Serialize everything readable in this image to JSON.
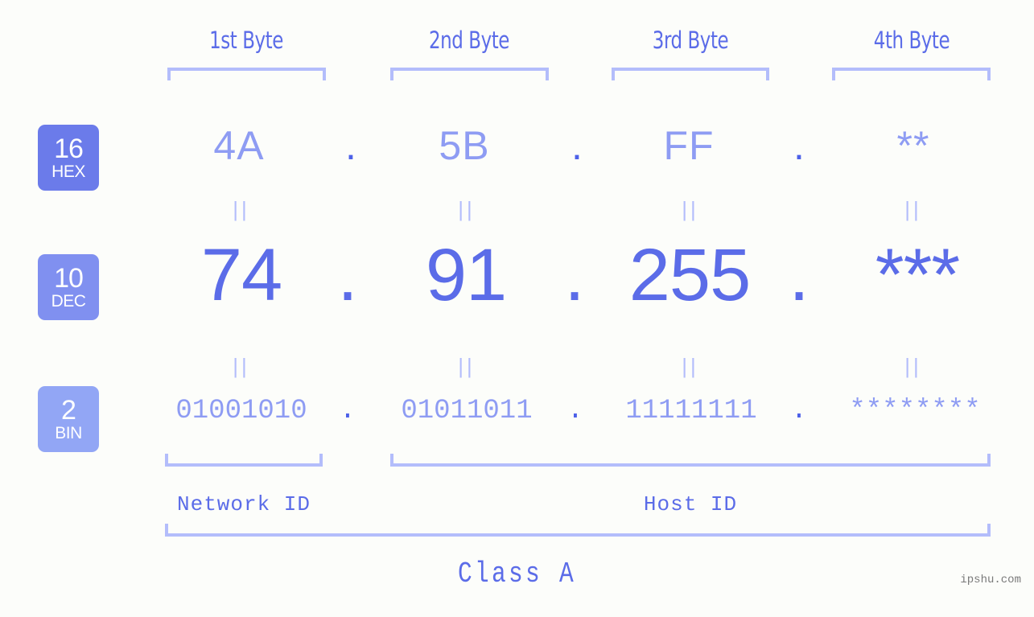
{
  "background_color": "#fcfdfa",
  "accent_colors": {
    "strong_blue": "#5b6ce8",
    "mid_blue": "#8e9cf3",
    "light_blue": "#b3bdfb",
    "badge_hex": "#6b7bea",
    "badge_dec": "#8090f0",
    "badge_bin": "#92a6f5"
  },
  "headers": [
    {
      "label": "1st Byte"
    },
    {
      "label": "2nd Byte"
    },
    {
      "label": "3rd Byte"
    },
    {
      "label": "4th Byte"
    }
  ],
  "bases": [
    {
      "id": "hex",
      "number": "16",
      "name": "HEX",
      "color": "#6b7bea"
    },
    {
      "id": "dec",
      "number": "10",
      "name": "DEC",
      "color": "#8090f0"
    },
    {
      "id": "bin",
      "number": "2",
      "name": "BIN",
      "color": "#92a6f5"
    }
  ],
  "rows": {
    "hex": {
      "values": [
        "4A",
        "5B",
        "FF",
        "**"
      ],
      "separator": "."
    },
    "dec": {
      "values": [
        "74",
        "91",
        "255",
        "***"
      ],
      "separator": "."
    },
    "bin": {
      "values": [
        "01001010",
        "01011011",
        "11111111",
        "********"
      ],
      "separator": "."
    }
  },
  "equals_connectors": {
    "glyph": "||",
    "count_per_row": 4
  },
  "segments": {
    "network_id": "Network ID",
    "host_id": "Host ID"
  },
  "class_label": "Class A",
  "watermark": "ipshu.com"
}
